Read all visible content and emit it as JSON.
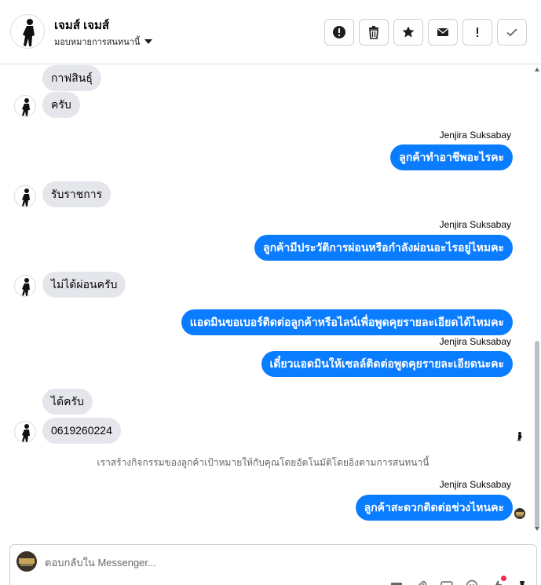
{
  "header": {
    "name": "เจมส์ เจมส์",
    "assign_label": "มอบหมายการสนทนานี้",
    "actions": [
      {
        "id": "spam",
        "icon": "alert-circle-icon"
      },
      {
        "id": "delete",
        "icon": "trash-icon"
      },
      {
        "id": "star",
        "icon": "star-icon"
      },
      {
        "id": "mail",
        "icon": "mail-icon"
      },
      {
        "id": "important",
        "icon": "exclamation-icon"
      },
      {
        "id": "done",
        "icon": "check-icon"
      }
    ]
  },
  "messages": [
    {
      "type": "in",
      "text": "กาฟสินธุ์",
      "avatar": false
    },
    {
      "type": "in",
      "text": "ครับ",
      "avatar": true
    },
    {
      "type": "out",
      "sender": "Jenjira Suksabay",
      "text": "ลูกค้าทำอาชีพอะไรคะ"
    },
    {
      "type": "in",
      "text": "รับราชการ",
      "avatar": true
    },
    {
      "type": "out",
      "sender": "Jenjira Suksabay",
      "text": "ลูกค้ามีประวัติการผ่อนหรือกำลังผ่อนอะไรอยู่ไหมคะ"
    },
    {
      "type": "in",
      "text": "ไม่ได้ผ่อนครับ",
      "avatar": true
    },
    {
      "type": "out",
      "text": "แอดมินขอเบอร์ติดต่อลูกค้าหรือไลน์เพื่อพูดคุยรายละเอียดได้ไหมคะ"
    },
    {
      "type": "out",
      "sender": "Jenjira Suksabay",
      "text": "เดี๋ยวแอดมินให้เซลล์ติดต่อพูดคุยรายละเอียดนะคะ"
    },
    {
      "type": "in",
      "text": "ได้ครับ",
      "avatar": false
    },
    {
      "type": "in",
      "text": "0619260224",
      "avatar": true
    },
    {
      "type": "system",
      "text": "เราสร้างกิจกรรมของลูกค้าเป้าหมายให้กับคุณโดยอัตโนมัติโดยอิงตามการสนทนานี้"
    },
    {
      "type": "out",
      "sender": "Jenjira Suksabay",
      "text": "ลูกค้าสะดวกติดต่อช่วงไหนคะ"
    }
  ],
  "composer": {
    "placeholder": "ตอบกลับใน Messenger...",
    "tools": [
      "gift-icon",
      "attachment-icon",
      "gif-icon",
      "emoji-icon",
      "like-icon",
      "pin-icon"
    ]
  },
  "colors": {
    "outgoing_bubble": "#0a7cff",
    "incoming_bubble": "#e4e6eb",
    "notification_dot": "#f02849"
  }
}
